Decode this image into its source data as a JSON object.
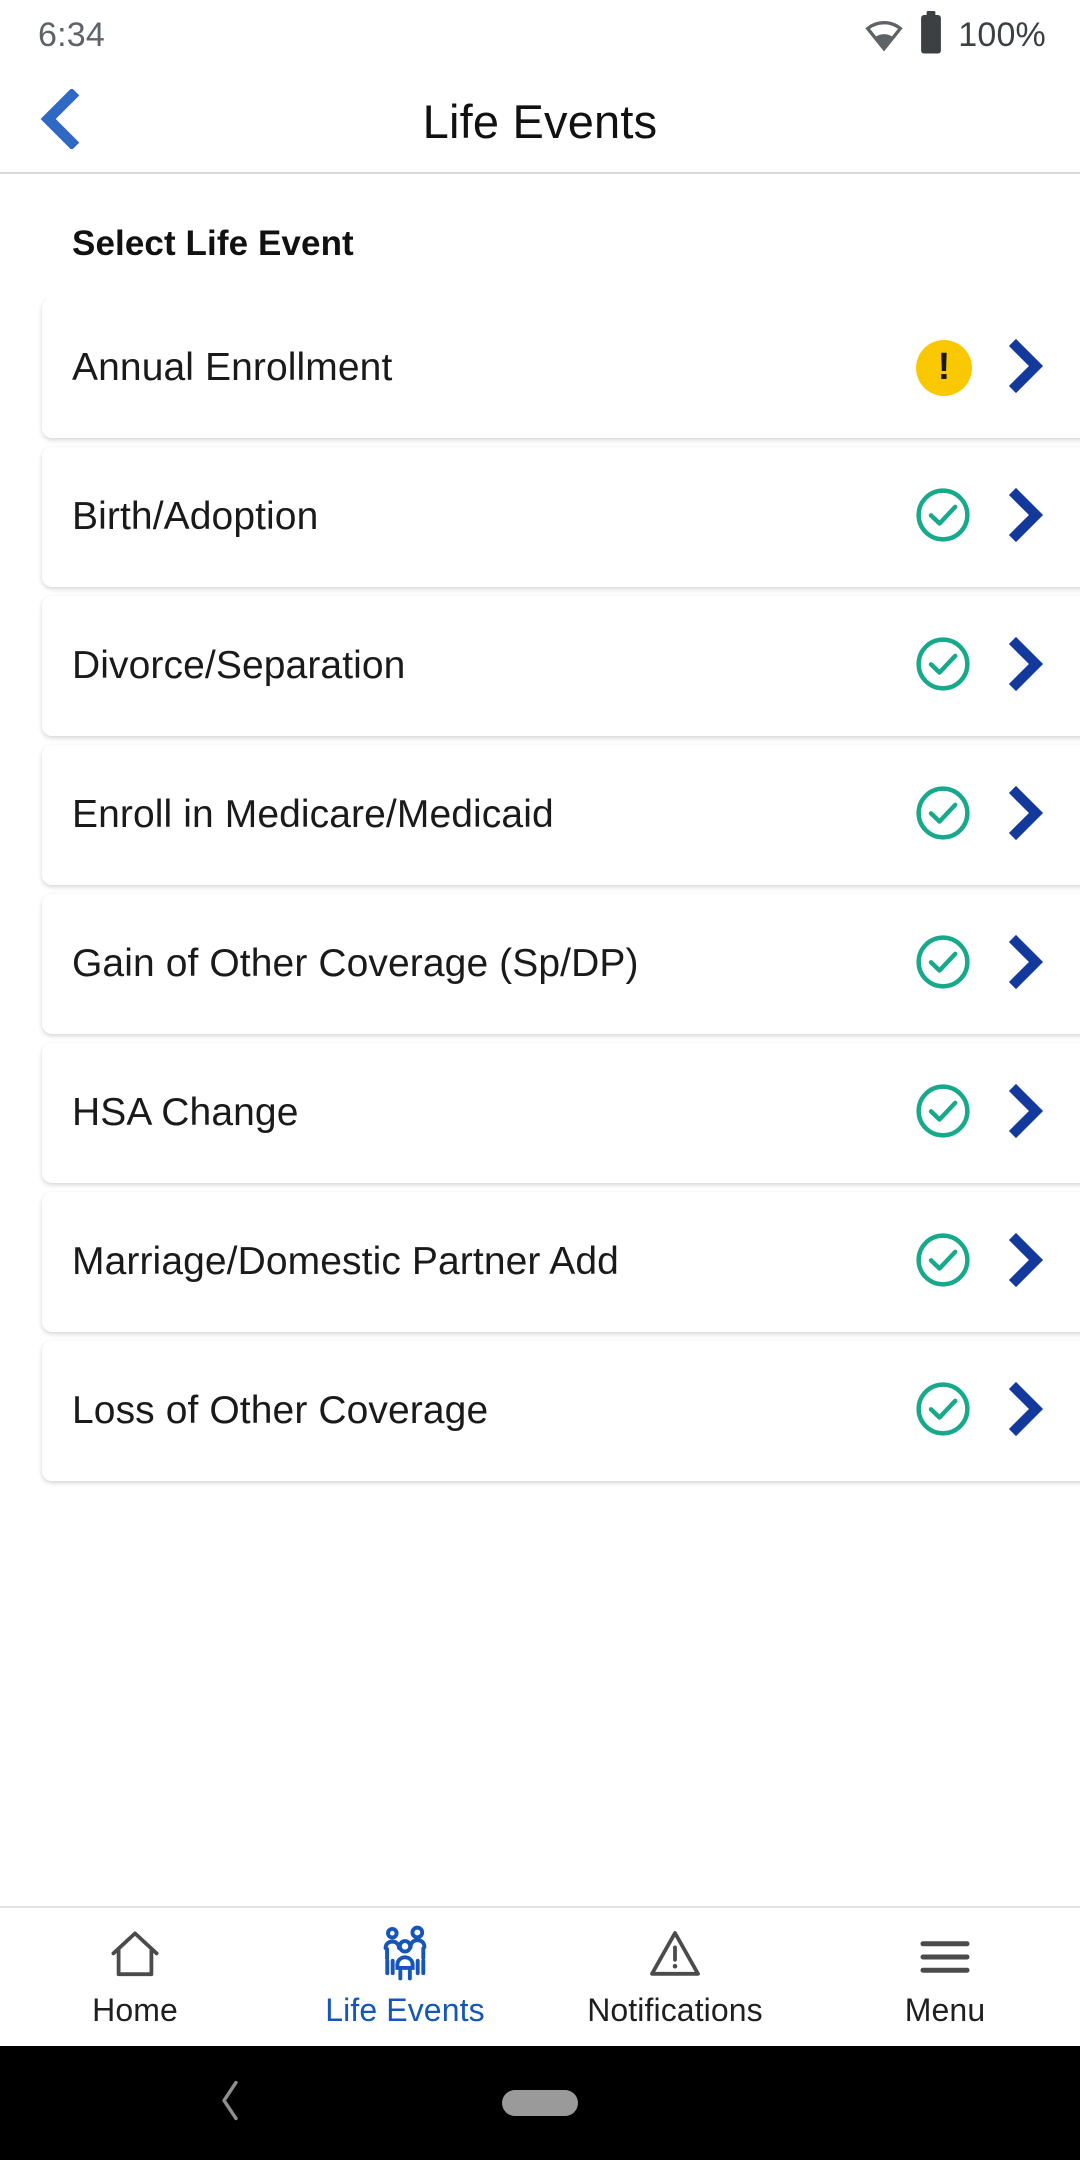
{
  "status_bar": {
    "time": "6:34",
    "battery_text": "100%",
    "wifi_icon": "wifi-icon",
    "battery_icon": "battery-full-icon"
  },
  "header": {
    "title": "Life Events",
    "back_icon": "chevron-left-icon"
  },
  "main": {
    "section_title": "Select Life Event",
    "items": [
      {
        "label": "Annual Enrollment",
        "status": "warning",
        "status_icon": "exclamation-badge-icon",
        "chevron_icon": "chevron-right-icon"
      },
      {
        "label": "Birth/Adoption",
        "status": "complete",
        "status_icon": "check-circle-icon",
        "chevron_icon": "chevron-right-icon"
      },
      {
        "label": "Divorce/Separation",
        "status": "complete",
        "status_icon": "check-circle-icon",
        "chevron_icon": "chevron-right-icon"
      },
      {
        "label": "Enroll in Medicare/Medicaid",
        "status": "complete",
        "status_icon": "check-circle-icon",
        "chevron_icon": "chevron-right-icon"
      },
      {
        "label": "Gain of Other Coverage (Sp/DP)",
        "status": "complete",
        "status_icon": "check-circle-icon",
        "chevron_icon": "chevron-right-icon"
      },
      {
        "label": "HSA Change",
        "status": "complete",
        "status_icon": "check-circle-icon",
        "chevron_icon": "chevron-right-icon"
      },
      {
        "label": "Marriage/Domestic Partner Add",
        "status": "complete",
        "status_icon": "check-circle-icon",
        "chevron_icon": "chevron-right-icon"
      },
      {
        "label": "Loss of Other Coverage",
        "status": "complete",
        "status_icon": "check-circle-icon",
        "chevron_icon": "chevron-right-icon"
      }
    ],
    "warning_mark": "!"
  },
  "tabbar": {
    "active": "Life Events",
    "tabs": [
      {
        "label": "Home",
        "icon": "home-icon"
      },
      {
        "label": "Life Events",
        "icon": "family-group-icon"
      },
      {
        "label": "Notifications",
        "icon": "warning-triangle-icon"
      },
      {
        "label": "Menu",
        "icon": "hamburger-menu-icon"
      }
    ]
  },
  "nav_bar": {
    "back_icon": "nav-back-icon",
    "home_pill_icon": "nav-home-pill-icon"
  },
  "colors": {
    "accent_blue": "#1656b8",
    "chevron_blue": "#14399c",
    "warning_yellow": "#FAC800",
    "success_teal": "#16a98b",
    "text_dark": "#1a1a1a"
  }
}
